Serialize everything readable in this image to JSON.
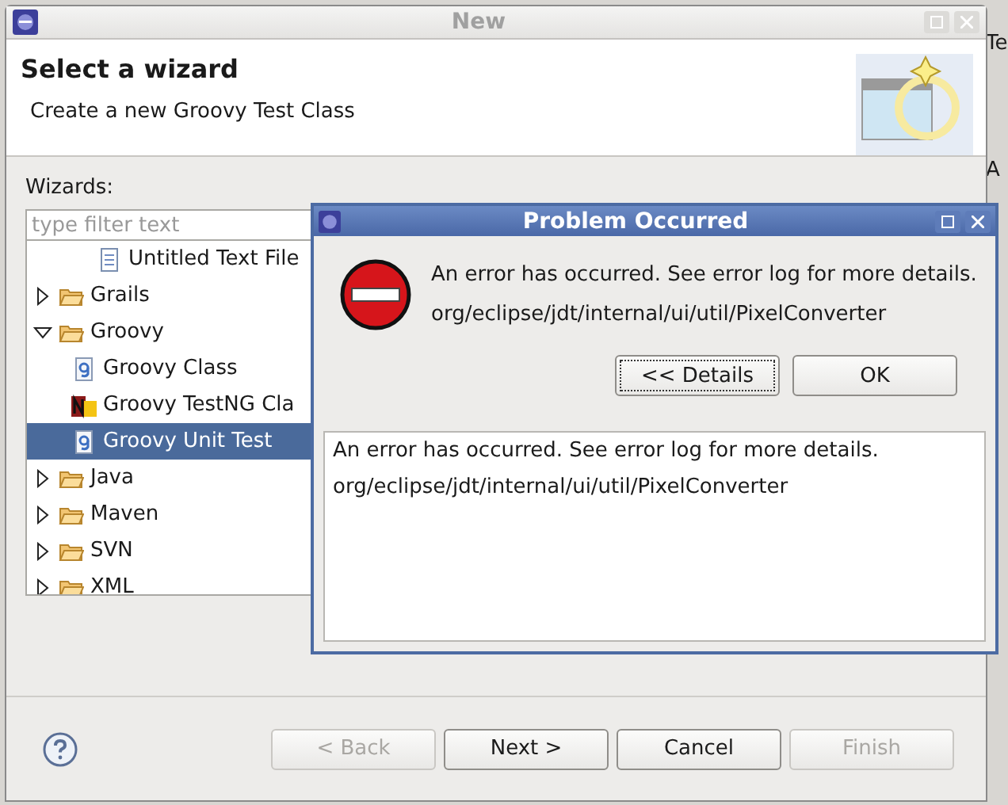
{
  "background": {
    "texts": [
      "Te",
      "A"
    ]
  },
  "window": {
    "title": "New"
  },
  "header": {
    "title": "Select a wizard",
    "description": "Create a new Groovy Test Class"
  },
  "wizards": {
    "label": "Wizards:",
    "filter": {
      "placeholder": "type filter text"
    },
    "tree": [
      {
        "label": "Untitled Text File",
        "kind": "file",
        "selected": false
      },
      {
        "label": "Grails",
        "kind": "folder",
        "expanded": false,
        "selected": false
      },
      {
        "label": "Groovy",
        "kind": "folder",
        "expanded": true,
        "selected": false,
        "children": [
          {
            "label": "Groovy Class",
            "kind": "groovy",
            "selected": false
          },
          {
            "label": "Groovy TestNG Cla",
            "kind": "testng",
            "selected": false
          },
          {
            "label": "Groovy Unit Test",
            "kind": "groovy",
            "selected": true
          }
        ]
      },
      {
        "label": "Java",
        "kind": "folder",
        "expanded": false,
        "selected": false
      },
      {
        "label": "Maven",
        "kind": "folder",
        "expanded": false,
        "selected": false
      },
      {
        "label": "SVN",
        "kind": "folder",
        "expanded": false,
        "selected": false
      },
      {
        "label": "XML",
        "kind": "folder",
        "expanded": false,
        "selected": false
      }
    ]
  },
  "buttons": [
    {
      "label": "< Back",
      "disabled": true
    },
    {
      "label": "Next >",
      "disabled": false
    },
    {
      "label": "Cancel",
      "disabled": false
    },
    {
      "label": "Finish",
      "disabled": true
    }
  ],
  "error_dialog": {
    "title": "Problem Occurred",
    "message": "An error has occurred. See error log for more details.",
    "detail": "org/eclipse/jdt/internal/ui/util/PixelConverter",
    "buttons": [
      {
        "label": "<< Details",
        "focused": true
      },
      {
        "label": "OK",
        "focused": false
      }
    ],
    "details_text": [
      "An error has occurred. See error log for more details.",
      "org/eclipse/jdt/internal/ui/util/PixelConverter"
    ]
  }
}
